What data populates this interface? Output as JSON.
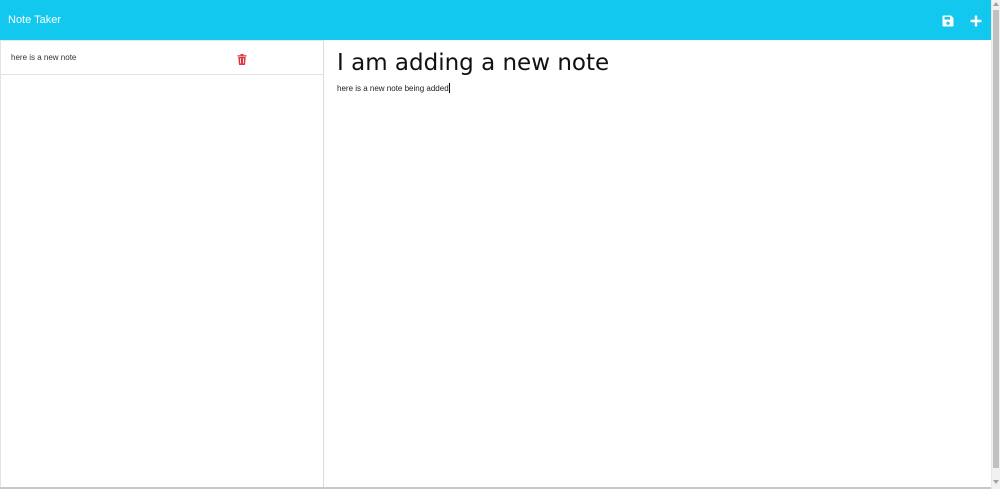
{
  "navbar": {
    "brand": "Note Taker",
    "icons": [
      "save-icon",
      "plus-icon"
    ],
    "background_color": "#13c8ef"
  },
  "sidebar": {
    "notes": [
      {
        "title": "here is a new note",
        "delete_icon": "trash-icon"
      }
    ],
    "delete_color": "#dc3545"
  },
  "editor": {
    "title_value": "I am adding a new note",
    "body_value": "here is a new note being added"
  }
}
